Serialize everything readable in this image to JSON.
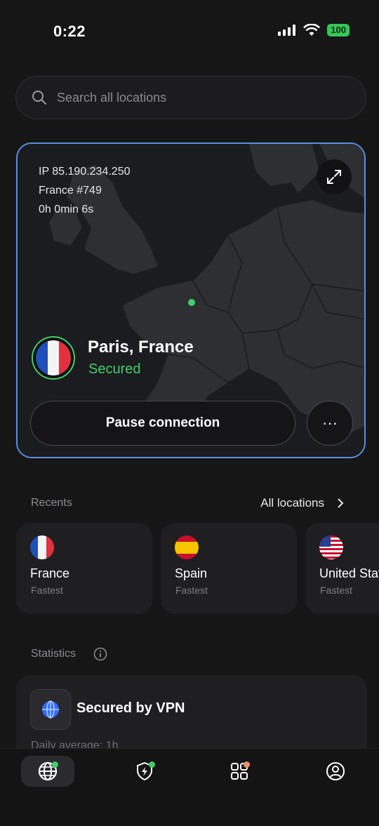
{
  "status_bar": {
    "time": "0:22",
    "battery": "100"
  },
  "search": {
    "placeholder": "Search all locations"
  },
  "connection": {
    "ip": "IP 85.190.234.250",
    "server": "France #749",
    "duration": "0h 0min 6s",
    "location": "Paris, France",
    "status": "Secured",
    "pause_label": "Pause connection",
    "more_label": "···",
    "status_color": "#3ecf6a",
    "border_color": "#5b8fe0"
  },
  "recents": {
    "title": "Recents",
    "all_label": "All locations",
    "items": [
      {
        "name": "France",
        "sub": "Fastest",
        "flag": "france-flag"
      },
      {
        "name": "Spain",
        "sub": "Fastest",
        "flag": "spain-flag"
      },
      {
        "name": "United States",
        "sub": "Fastest",
        "flag": "us-flag"
      }
    ]
  },
  "statistics": {
    "title": "Statistics",
    "card_title": "Secured by VPN",
    "daily": "Daily average: 1h"
  },
  "tabbar": {
    "items": [
      {
        "icon": "globe-icon",
        "active": true
      },
      {
        "icon": "shield-bolt-icon",
        "active": false
      },
      {
        "icon": "apps-icon",
        "active": false
      },
      {
        "icon": "profile-icon",
        "active": false
      }
    ]
  }
}
